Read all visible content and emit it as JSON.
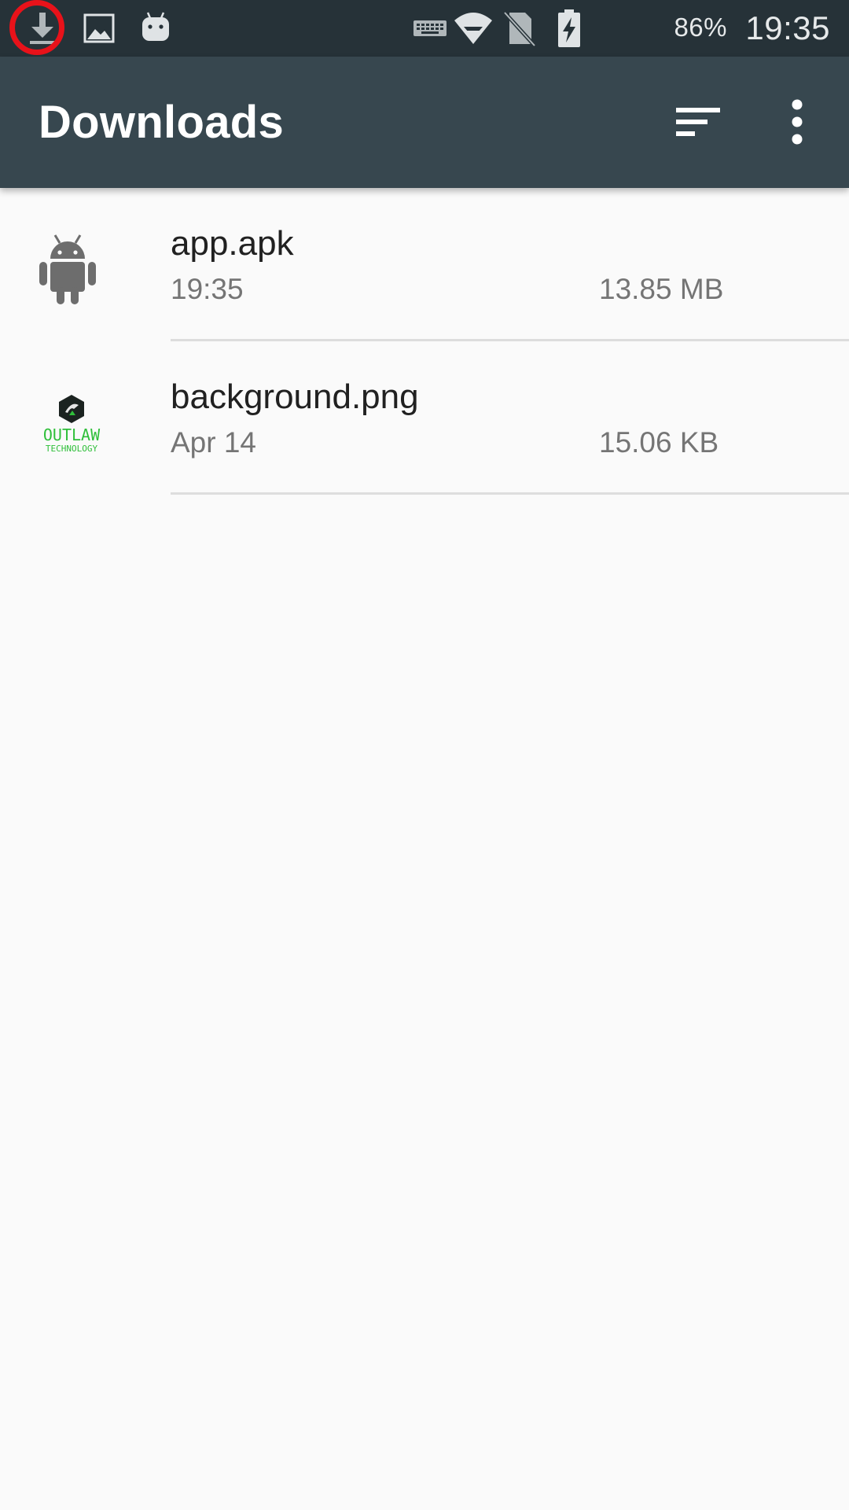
{
  "status_bar": {
    "left_icons": [
      "download-icon",
      "image-icon",
      "android-notification-icon"
    ],
    "right_icons": [
      "keyboard-icon",
      "wifi-icon",
      "no-sim-icon",
      "battery-charging-icon"
    ],
    "battery_percent": "86%",
    "time": "19:35"
  },
  "app_bar": {
    "title": "Downloads",
    "actions": [
      "sort-icon",
      "more-vert-icon"
    ],
    "background": "#37474f"
  },
  "files": [
    {
      "name": "app.apk",
      "date": "19:35",
      "size": "13.85 MB",
      "thumbnail": "android-icon"
    },
    {
      "name": "background.png",
      "date": "Apr 14",
      "size": "15.06 KB",
      "thumbnail": "outlaw-technology-logo",
      "thumbnail_text": [
        "OUTLAW",
        "TECHNOLOGY"
      ]
    }
  ],
  "colors": {
    "status_bar": "#263238",
    "highlight": "#e8121a",
    "logo_green": "#2fbf3a"
  }
}
